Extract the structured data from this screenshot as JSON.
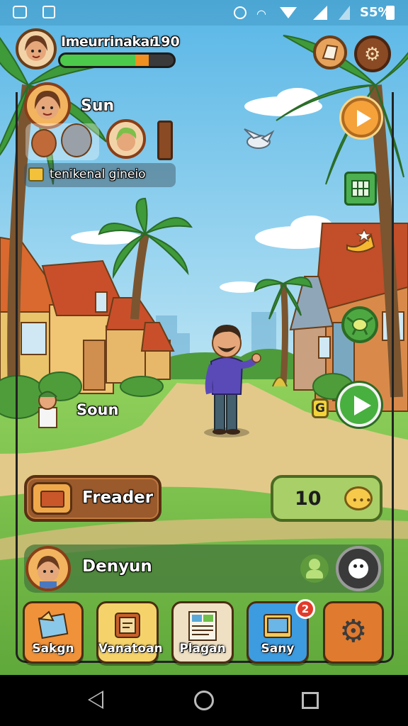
{
  "status_bar": {
    "battery_text": "S5%"
  },
  "player": {
    "name": "Imeurrinakan",
    "level": "190",
    "xp_fraction": 0.78
  },
  "party": {
    "leader_name": "Sun",
    "quest_text": "tenikenal gineio"
  },
  "field": {
    "child_name": "Soun",
    "badge_letter": "G"
  },
  "main_panel": {
    "left_label": "Freader",
    "counter_value": "10"
  },
  "dialog_bar": {
    "name": "Denyun"
  },
  "bottom_menu": {
    "items": [
      "Sakgn",
      "Vanatoan",
      "Plagan",
      "Sany",
      ""
    ],
    "notification_badge": "2"
  },
  "colors": {
    "sky": "#8fd2ef",
    "grass": "#7dc24b",
    "xp_green": "#4cc94a",
    "panel_brown": "#7a4a22"
  }
}
